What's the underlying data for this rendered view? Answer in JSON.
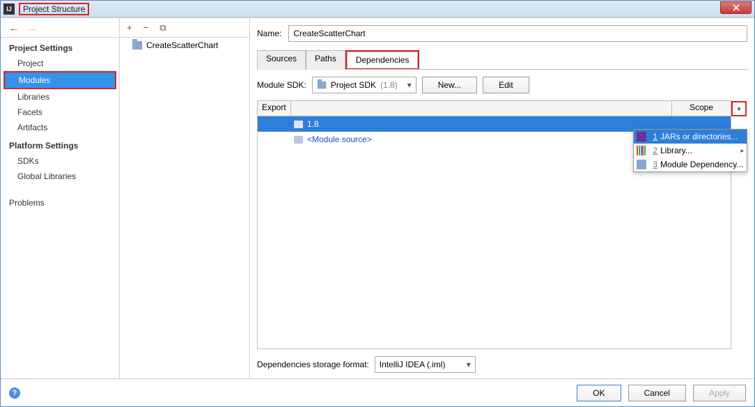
{
  "window": {
    "title": "Project Structure"
  },
  "sidebar": {
    "section1_title": "Project Settings",
    "section2_title": "Platform Settings",
    "items1": [
      "Project",
      "Modules",
      "Libraries",
      "Facets",
      "Artifacts"
    ],
    "items2": [
      "SDKs",
      "Global Libraries"
    ],
    "problems": "Problems"
  },
  "tree": {
    "module": "CreateScatterChart"
  },
  "form": {
    "name_label": "Name:",
    "name_value": "CreateScatterChart"
  },
  "tabs": [
    "Sources",
    "Paths",
    "Dependencies"
  ],
  "sdk": {
    "label": "Module SDK:",
    "selected_prefix": "Project SDK",
    "selected_suffix": "(1.8)",
    "new_btn": "New...",
    "edit_btn": "Edit"
  },
  "dep_table": {
    "col_export": "Export",
    "col_scope": "Scope",
    "rows": [
      {
        "label": "1.8"
      },
      {
        "label": "<Module source>"
      }
    ]
  },
  "popup": {
    "items": [
      {
        "n": "1",
        "label": "JARs or directories..."
      },
      {
        "n": "2",
        "label": "Library..."
      },
      {
        "n": "3",
        "label": "Module Dependency..."
      }
    ]
  },
  "storage": {
    "label": "Dependencies storage format:",
    "value": "IntelliJ IDEA (.iml)"
  },
  "buttons": {
    "ok": "OK",
    "cancel": "Cancel",
    "apply": "Apply"
  }
}
